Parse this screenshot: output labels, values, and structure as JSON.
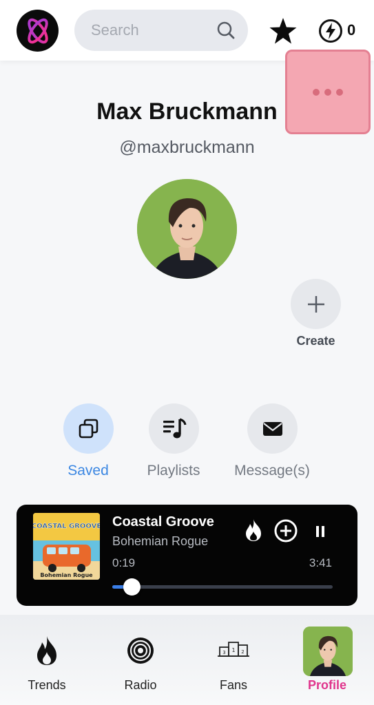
{
  "header": {
    "search_placeholder": "Search",
    "energy_count": "0",
    "icons": {
      "logo": "app-logo-icon",
      "search": "search-icon",
      "star": "star-icon",
      "energy": "lightning-bolt-icon",
      "more": "more-options-icon"
    }
  },
  "profile": {
    "name": "Max Bruckmann",
    "handle": "@maxbruckmann",
    "create_label": "Create"
  },
  "actions": [
    {
      "label": "Saved",
      "icon": "copy-stack-icon",
      "active": true
    },
    {
      "label": "Playlists",
      "icon": "playlist-music-icon",
      "active": false
    },
    {
      "label": "Message(s)",
      "icon": "envelope-icon",
      "active": false
    }
  ],
  "player": {
    "title": "Coastal Groove",
    "artist": "Bohemian Rogue",
    "current_time": "0:19",
    "total_time": "3:41",
    "progress_fraction": 0.086,
    "cover_text_top": "COASTAL GROOVE",
    "cover_text_bottom": "Bohemian Rogue",
    "icons": [
      "fire-icon",
      "add-circle-icon",
      "pause-icon"
    ]
  },
  "nav": [
    {
      "label": "Trends",
      "icon": "flame-icon",
      "active": false
    },
    {
      "label": "Radio",
      "icon": "radio-broadcast-icon",
      "active": false
    },
    {
      "label": "Fans",
      "icon": "podium-icon",
      "active": false
    },
    {
      "label": "Profile",
      "icon": "profile-avatar",
      "active": true
    }
  ],
  "colors": {
    "accent_blue": "#3a86e2",
    "accent_pink": "#e0348c",
    "highlight_box": "#f4a7b2",
    "player_bg": "#050505"
  }
}
